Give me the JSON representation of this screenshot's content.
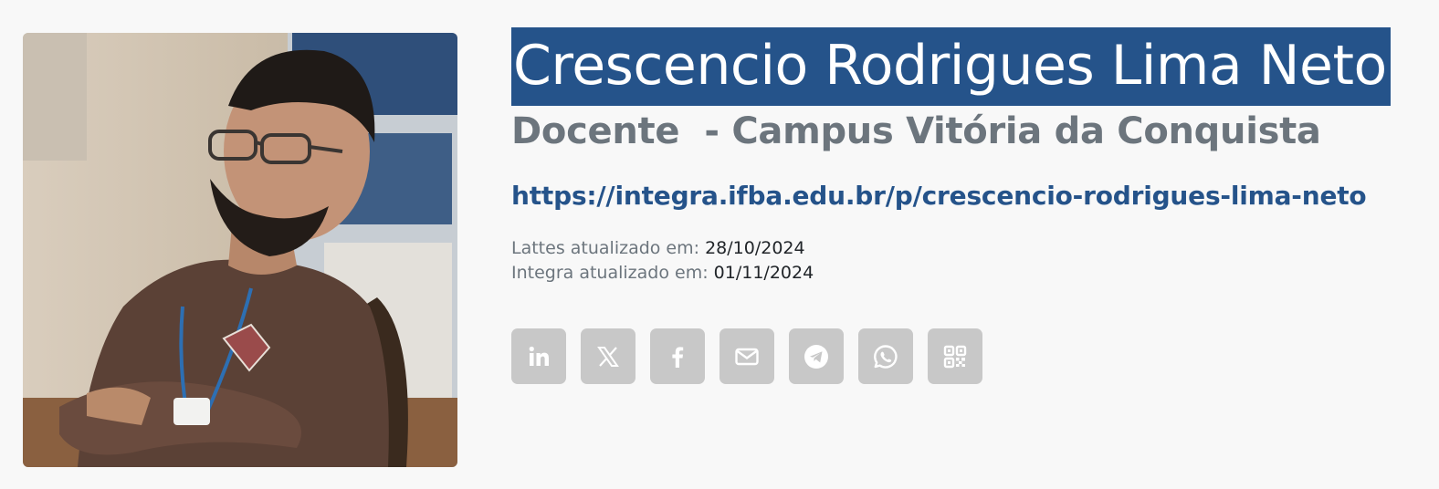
{
  "profile": {
    "photo_alt": "Crescencio Rodrigues Lima Neto",
    "name": "Crescencio Rodrigues Lima Neto",
    "role": "Docente  - Campus Vitória da Conquista",
    "url": "https://integra.ifba.edu.br/p/crescencio-rodrigues-lima-neto",
    "updates": [
      {
        "label": "Lattes atualizado em:",
        "value": "28/10/2024"
      },
      {
        "label": "Integra atualizado em:",
        "value": "01/11/2024"
      }
    ]
  },
  "social": [
    {
      "icon": "linkedin-icon"
    },
    {
      "icon": "x-icon"
    },
    {
      "icon": "facebook-icon"
    },
    {
      "icon": "email-icon"
    },
    {
      "icon": "telegram-icon"
    },
    {
      "icon": "whatsapp-icon"
    },
    {
      "icon": "qrcode-icon"
    }
  ],
  "colors": {
    "name_background": "#25538a",
    "link": "#25538a",
    "muted_text": "#6c757d",
    "icon_button": "#c8c8c8",
    "page_background": "#f8f8f8"
  }
}
